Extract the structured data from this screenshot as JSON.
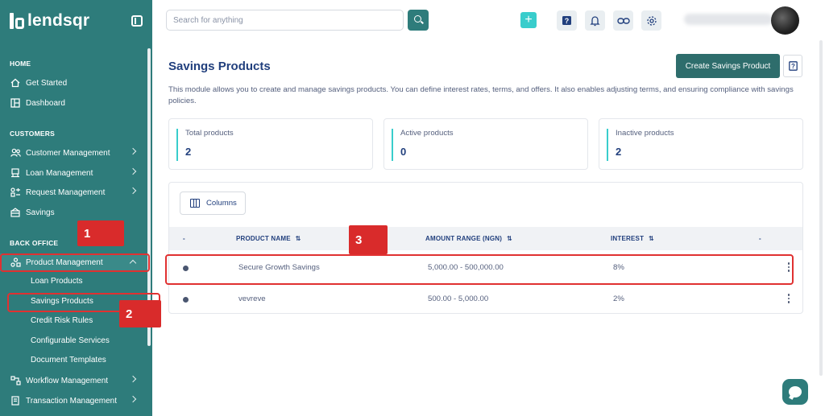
{
  "brand": {
    "name": "lendsqr"
  },
  "sidebar": {
    "sections": {
      "home": "HOME",
      "customers": "CUSTOMERS",
      "back_office": "BACK OFFICE"
    },
    "items": {
      "get_started": "Get Started",
      "dashboard": "Dashboard",
      "customer_management": "Customer Management",
      "loan_management": "Loan Management",
      "request_management": "Request Management",
      "savings": "Savings",
      "product_management": "Product Management",
      "workflow_management": "Workflow Management",
      "transaction_management": "Transaction Management"
    },
    "sub_items": {
      "loan_products": "Loan Products",
      "savings_products": "Savings Products",
      "credit_risk_rules": "Credit Risk Rules",
      "configurable_services": "Configurable Services",
      "document_templates": "Document Templates"
    }
  },
  "annotations": {
    "one": "1",
    "two": "2",
    "three": "3"
  },
  "topbar": {
    "search_placeholder": "Search for anything",
    "add_label": "+",
    "icons": [
      "help-icon",
      "bell-icon",
      "link-icon",
      "gear-icon"
    ]
  },
  "main": {
    "title": "Savings Products",
    "create_button": "Create Savings Product",
    "description": "This module allows you to create and manage savings products. You can define interest rates, terms, and offers. It also enables adjusting terms, and ensuring compliance with savings policies."
  },
  "stats": [
    {
      "label": "Total products",
      "value": "2"
    },
    {
      "label": "Active products",
      "value": "0"
    },
    {
      "label": "Inactive products",
      "value": "2"
    }
  ],
  "table": {
    "columns_button": "Columns",
    "headers": {
      "status": "-",
      "product_name": "PRODUCT NAME",
      "amount_range": "AMOUNT RANGE (NGN)",
      "interest": "INTEREST",
      "actions": "-"
    },
    "rows": [
      {
        "name": "Secure Growth Savings",
        "amount_range": "5,000.00 - 500,000.00",
        "interest": "8%"
      },
      {
        "name": "vevreve",
        "amount_range": "500.00 - 5,000.00",
        "interest": "2%"
      }
    ]
  },
  "colors": {
    "sidebar": "#2e7c7b",
    "accent": "#39cdcc",
    "text": "#213f7d",
    "annotation": "#e03131"
  }
}
